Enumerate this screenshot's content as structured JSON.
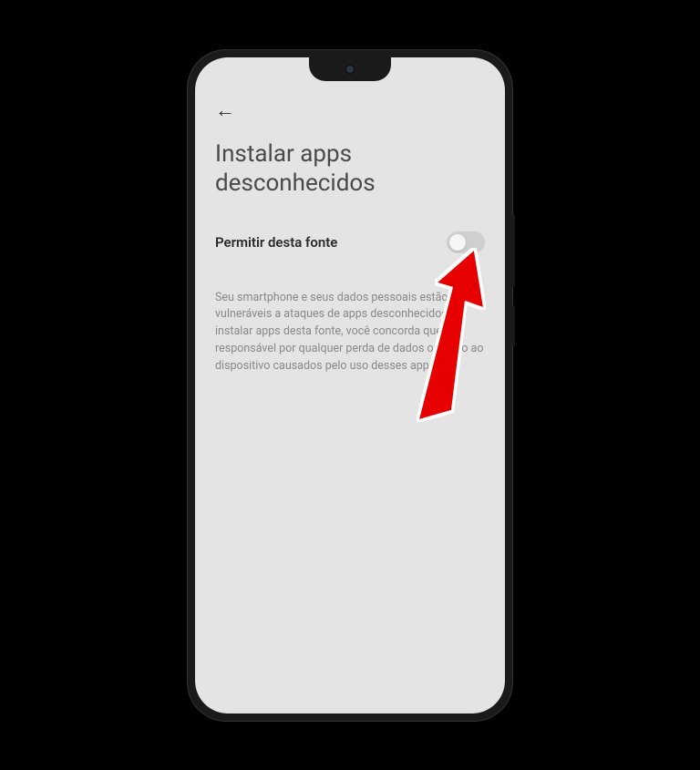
{
  "header": {
    "title": "Instalar apps desconhecidos"
  },
  "setting": {
    "label": "Permitir desta fonte",
    "enabled": false
  },
  "description": {
    "text": "Seu smartphone e seus dados pessoais estão mais vulneráveis a ataques de apps desconhecidos. Ao instalar apps desta fonte, você concorda que é responsável por qualquer perda de dados ou dano ao dispositivo causados pelo uso desses apps."
  },
  "annotation": {
    "arrow_color": "#e60000"
  }
}
